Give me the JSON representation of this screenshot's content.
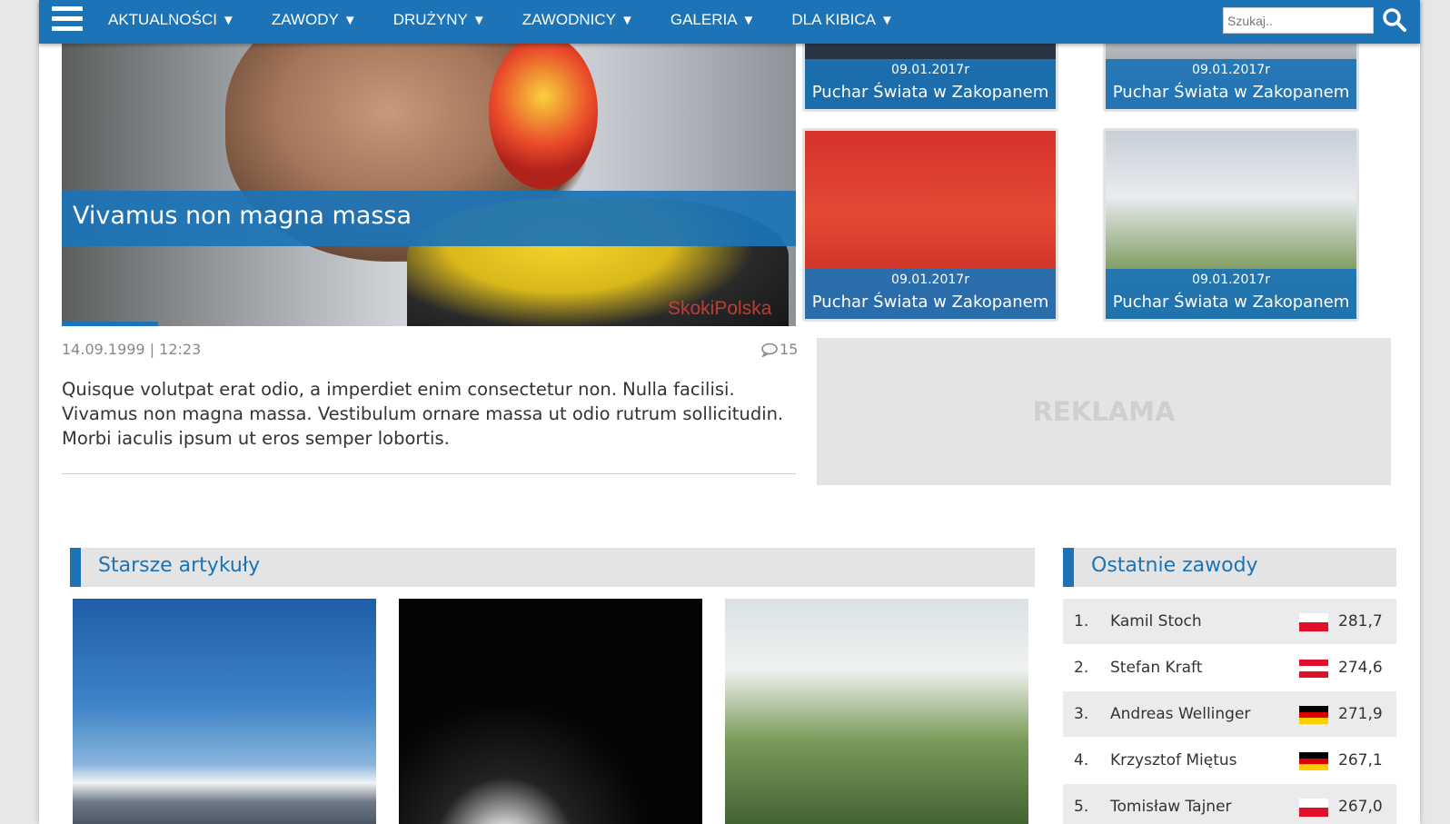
{
  "nav": {
    "menu": [
      {
        "label": "AKTUALNOŚCI",
        "caret": "▼"
      },
      {
        "label": "ZAWODY",
        "caret": "▼"
      },
      {
        "label": "DRUŻYNY",
        "caret": "▼"
      },
      {
        "label": "ZAWODNICY",
        "caret": "▼"
      },
      {
        "label": "GALERIA",
        "caret": "▼"
      },
      {
        "label": "DLA KIBICA",
        "caret": "▼"
      }
    ],
    "search_placeholder": "Szukaj..",
    "icons": {
      "menu": "hamburger-icon",
      "search": "search-icon"
    },
    "accent_color": "#1c73b6"
  },
  "hero": {
    "title": "Vivamus non magna massa",
    "watermark": "SkokiPolska",
    "date": "14.09.1999 | 12:23",
    "comments": "15",
    "excerpt": "Quisque volutpat erat odio, a imperdiet enim consectetur non. Nulla facilisi. Vivamus non magna massa. Vestibulum ornare massa ut odio rutrum sollicitudin. Morbi iaculis ipsum ut eros semper lobortis."
  },
  "thumbs": [
    {
      "date": "09.01.2017r",
      "title": "Puchar Świata w Zakopanem"
    },
    {
      "date": "09.01.2017r",
      "title": "Puchar Świata w Zakopanem"
    },
    {
      "date": "09.01.2017r",
      "title": "Puchar Świata w Zakopanem"
    },
    {
      "date": "09.01.2017r",
      "title": "Puchar Świata w Zakopanem"
    }
  ],
  "ad": {
    "label": "REKLAMA"
  },
  "sections": {
    "older": "Starsze artykuły",
    "recent": "Ostatnie zawody"
  },
  "results": [
    {
      "pos": "1.",
      "name": "Kamil Stoch",
      "flag": "pl",
      "score": "281,7"
    },
    {
      "pos": "2.",
      "name": "Stefan Kraft",
      "flag": "at",
      "score": "274,6"
    },
    {
      "pos": "3.",
      "name": "Andreas Wellinger",
      "flag": "de",
      "score": "271,9"
    },
    {
      "pos": "4.",
      "name": "Krzysztof Miętus",
      "flag": "de",
      "score": "267,1"
    },
    {
      "pos": "5.",
      "name": "Tomisław Tajner",
      "flag": "pl",
      "score": "267,0"
    }
  ]
}
